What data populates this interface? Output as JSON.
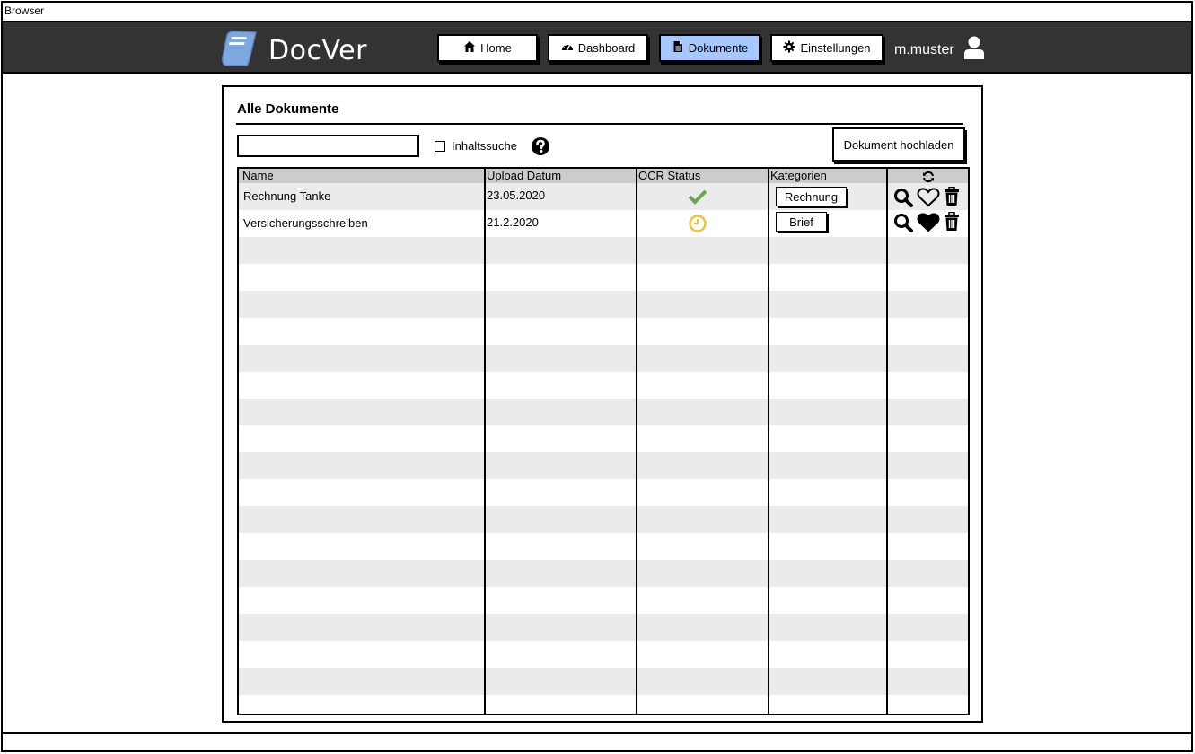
{
  "window": {
    "title": "Browser"
  },
  "app": {
    "name": "DocVer",
    "logo_color": "#7fa8e0",
    "topbar_color": "#333333",
    "active_color": "#a6c8ff"
  },
  "nav": {
    "items": [
      {
        "label": "Home",
        "icon": "home-icon"
      },
      {
        "label": "Dashboard",
        "icon": "dashboard-icon"
      },
      {
        "label": "Dokumente",
        "icon": "document-icon",
        "active": true
      },
      {
        "label": "Einstellungen",
        "icon": "gear-icon"
      }
    ],
    "user": "m.muster"
  },
  "main": {
    "title": "Alle Dokumente",
    "search": {
      "value": "",
      "placeholder": ""
    },
    "content_search_label": "Inhaltssuche",
    "content_search_checked": false,
    "upload_label": "Dokument hochladen"
  },
  "table": {
    "columns": [
      "Name",
      "Upload Datum",
      "OCR Status",
      "Kategorien"
    ],
    "refresh_icon": "refresh-icon",
    "rows": [
      {
        "name": "Rechnung Tanke",
        "date": "23.05.2020",
        "ocr": "done",
        "ocr_icon": "check-icon",
        "category": "Rechnung",
        "favorite": false
      },
      {
        "name": "Versicherungsschreiben",
        "date": "21.2.2020",
        "ocr": "pending",
        "ocr_icon": "clock-icon",
        "category": "Brief",
        "favorite": true
      }
    ],
    "status_colors": {
      "done": "#6aa84f",
      "pending": "#f1c232"
    }
  }
}
